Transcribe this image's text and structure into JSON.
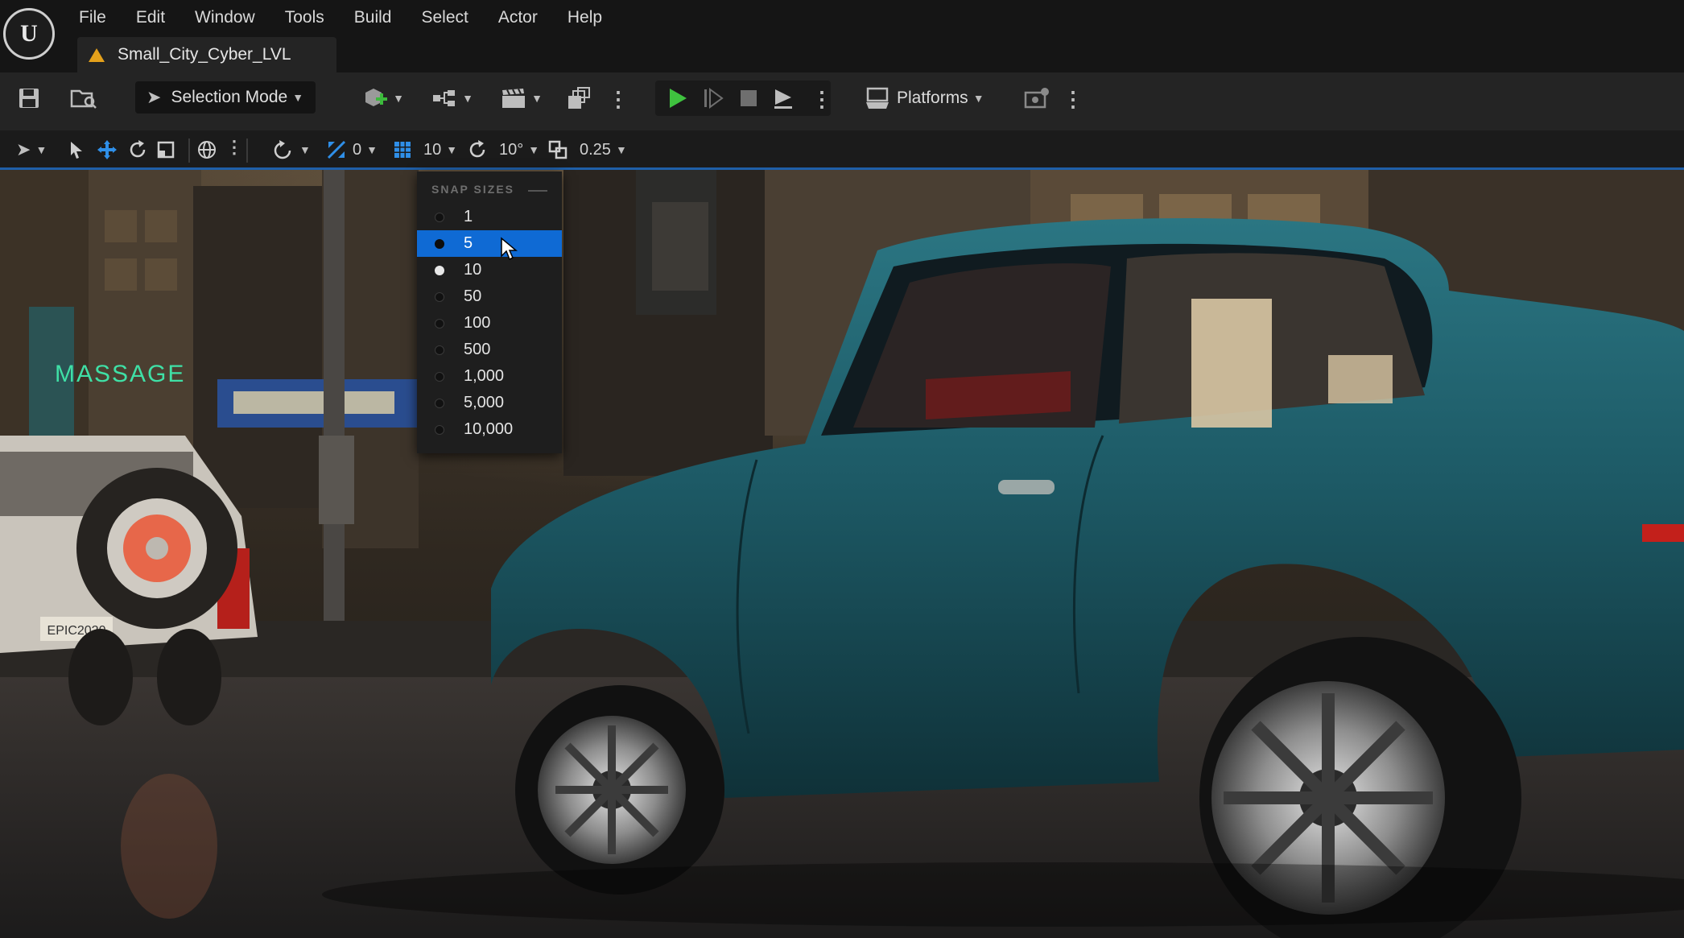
{
  "menubar": {
    "items": [
      "File",
      "Edit",
      "Window",
      "Tools",
      "Build",
      "Select",
      "Actor",
      "Help"
    ]
  },
  "tab": {
    "title": "Small_City_Cyber_LVL",
    "icon": "level-warning-icon"
  },
  "toolbar": {
    "selection_mode": "Selection Mode",
    "platforms": "Platforms"
  },
  "viewport_toolbar": {
    "scale_snap": "0",
    "grid_snap": "10",
    "rotation_snap": "10°",
    "camera_speed": "0.25"
  },
  "snap_menu": {
    "header": "SNAP SIZES",
    "selected": "5",
    "current_value": "10",
    "options": [
      "1",
      "5",
      "10",
      "50",
      "100",
      "500",
      "1,000",
      "5,000",
      "10,000"
    ]
  },
  "scene": {
    "signs": [
      "MASSAGE",
      "EPIC2020"
    ],
    "colors": {
      "car_body": "#1d5a66",
      "neon_sign": "#3fe0a6",
      "selection_blue": "#0f6ad4"
    }
  }
}
